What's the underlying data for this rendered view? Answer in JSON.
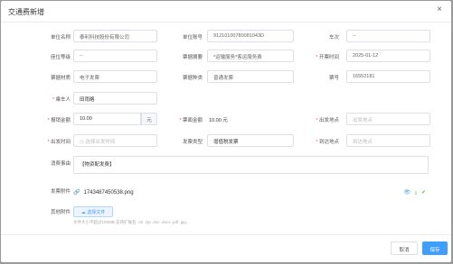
{
  "dialog": {
    "title": "交通费新增",
    "close": "×"
  },
  "fields": {
    "unit_name": {
      "label": "单位名称",
      "value": "泰利科技股份有限公司"
    },
    "unit_account": {
      "label": "单位账号",
      "value": "91210100780081043D"
    },
    "vehicle_no": {
      "label": "车次",
      "value": "--"
    },
    "seat_level": {
      "label": "座位等级",
      "value": "--"
    },
    "doc_summary": {
      "label": "票据摘要",
      "value": "*运输服务*客运服务费"
    },
    "issue_date": {
      "label": "开票时间",
      "value": "2025-01-12"
    },
    "doc_material": {
      "label": "票据材质",
      "value": "电子发票"
    },
    "doc_type": {
      "label": "票据种类",
      "value": "普通发票"
    },
    "doc_no": {
      "label": "票号",
      "value": "16552181"
    },
    "passenger": {
      "label": "乘车人",
      "value": "田雨略"
    },
    "reimburse_amount": {
      "label": "报销金额",
      "value": "10.00",
      "unit": "元"
    },
    "doc_amount": {
      "label": "票面金额",
      "value": "10.00 元"
    },
    "departure": {
      "label": "出发地点",
      "placeholder": "出发地点"
    },
    "depart_time": {
      "label": "出发时间",
      "placeholder": "选择出发时间"
    },
    "invoice_type": {
      "label": "发票类型",
      "value": "增值税发票"
    },
    "arrival": {
      "label": "到达地点",
      "placeholder": "到达地点"
    },
    "reason": {
      "label": "消费事由",
      "value": "【物资配发费】"
    }
  },
  "attachments": {
    "invoice_label": "发票附件",
    "invoice_file": "1743487450538.png",
    "other_label": "其他附件",
    "upload_button": "选择文件",
    "tip": "文件大小不超过100MB,支持扩展名 .rar .zip .doc .docx .pdf .jpg..."
  },
  "footer": {
    "cancel": "取消",
    "save": "保存"
  },
  "colors": {
    "primary": "#409eff",
    "required": "#e55555",
    "view_icon": "#409eff",
    "download_icon": "#67c23a",
    "ok_icon": "#67c23a"
  }
}
